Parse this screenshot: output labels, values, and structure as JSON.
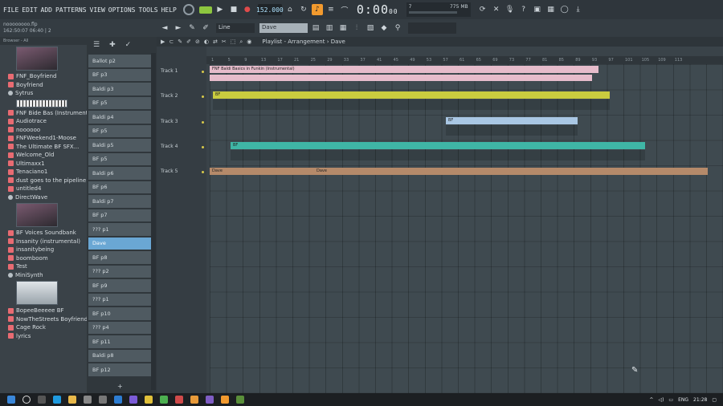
{
  "menu": [
    "FILE",
    "EDIT",
    "ADD",
    "PATTERNS",
    "VIEW",
    "OPTIONS",
    "TOOLS",
    "HELP"
  ],
  "transport": {
    "tempo": "152.000",
    "time": "0:00",
    "time_small": "00",
    "cpu": "775 MB",
    "cpu_val": "0",
    "cpu_pct": "7"
  },
  "toolbar2": {
    "project": "noooooooo.flp",
    "project2": "162:50:07",
    "project_sub": "06:40 | 2",
    "snap": "Line",
    "pattern": "Dave"
  },
  "browser": {
    "header": "Browser - All",
    "items": [
      {
        "type": "folder",
        "label": "FNF_Boyfriend"
      },
      {
        "type": "folder",
        "label": "Boyfriend"
      },
      {
        "type": "file",
        "label": "Sytrus"
      },
      {
        "type": "folder",
        "label": "FNF Bide Bas (Instrumental)"
      },
      {
        "type": "folder",
        "label": "Audiotrace"
      },
      {
        "type": "folder",
        "label": "noooooo"
      },
      {
        "type": "folder",
        "label": "FNFWeekend1-Moose"
      },
      {
        "type": "folder",
        "label": "The Ultimate BF SFX..."
      },
      {
        "type": "folder",
        "label": "Welcome_Old"
      },
      {
        "type": "folder",
        "label": "Ultimaxx1"
      },
      {
        "type": "folder",
        "label": "Tenaciano1"
      },
      {
        "type": "folder",
        "label": "dust goes to the pipeline"
      },
      {
        "type": "folder",
        "label": "untitled4"
      },
      {
        "type": "file",
        "label": "DirectWave"
      },
      {
        "type": "folder",
        "label": "BF Voices Soundbank"
      },
      {
        "type": "folder",
        "label": "Insanity (instrumental)"
      },
      {
        "type": "folder",
        "label": "insanitybeing"
      },
      {
        "type": "folder",
        "label": "boomboom"
      },
      {
        "type": "folder",
        "label": "Test"
      },
      {
        "type": "file",
        "label": "MiniSynth"
      },
      {
        "type": "folder",
        "label": "BopeeBeeeee BF"
      },
      {
        "type": "folder",
        "label": "NowTheStreets Boyfriend"
      },
      {
        "type": "folder",
        "label": "Cage Rock"
      },
      {
        "type": "folder",
        "label": "lyrics"
      }
    ]
  },
  "rack": {
    "patterns": [
      "Ballot p2",
      "BF p3",
      "Baldi p3",
      "BF p5",
      "Baldi p4",
      "BF p5",
      "Baldi p5",
      "BF p5",
      "Baldi p6",
      "BF p6",
      "Baldi p7",
      "BF p7",
      "??? p1",
      "Dave",
      "BF p8",
      "??? p2",
      "BF p9",
      "??? p1",
      "BF p10",
      "??? p4",
      "BF p11",
      "Baldi p8",
      "BF p12"
    ],
    "selected_index": 13,
    "add": "+"
  },
  "playlist": {
    "title": "Playlist - Arrangement",
    "pattern": "Dave",
    "tracks": [
      "Track 1",
      "Track 2",
      "Track 3",
      "Track 4",
      "Track 5"
    ],
    "timeline": [
      "1",
      "5",
      "9",
      "13",
      "17",
      "21",
      "25",
      "29",
      "33",
      "37",
      "41",
      "45",
      "49",
      "53",
      "57",
      "61",
      "65",
      "69",
      "73",
      "77",
      "81",
      "85",
      "89",
      "93",
      "97",
      "101",
      "105",
      "109",
      "113"
    ],
    "clips": {
      "c1": "FNF Baldi Basics in Funkin (Instrumental)",
      "c2": "BF",
      "c3": "BF",
      "c4": "BF",
      "c5a": "Dave",
      "c5b": "Dave"
    }
  },
  "taskbar": {
    "lang": "ENG",
    "clock": "21:28"
  },
  "colors": {
    "accent": "#f29a2e",
    "clip_pink": "#e6bccb",
    "clip_yellow": "#c9cc3f",
    "clip_blue": "#a9c7e4",
    "clip_teal": "#3fb6a6",
    "clip_brown": "#b58a6a"
  }
}
